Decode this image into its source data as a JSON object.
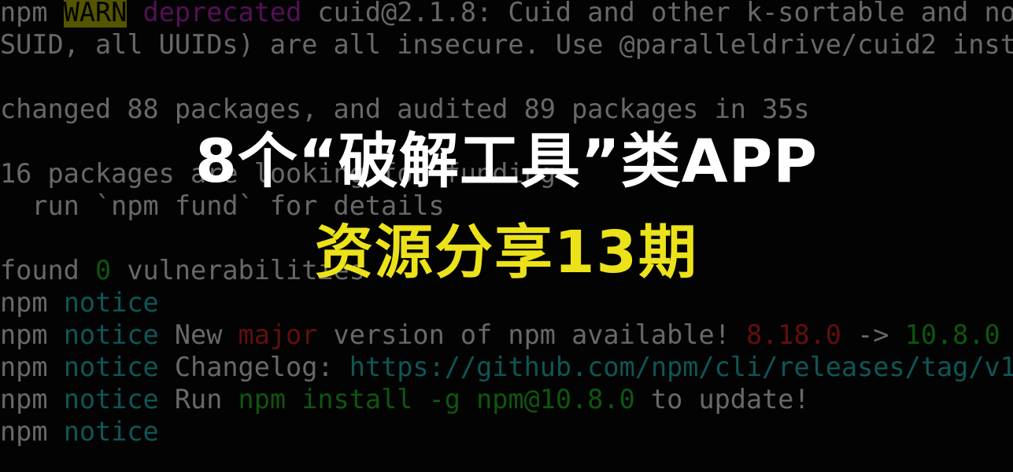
{
  "colors": {
    "background": "#050505",
    "text": "#a9a9a9",
    "green": "#1a8a1a",
    "red": "#a01818",
    "magenta": "#8a1a8a",
    "cyan": "#1a8a8a",
    "warn_badge_bg": "#8a8a00",
    "title_main": "#ffffff",
    "title_sub": "#ece21a"
  },
  "terminal": {
    "lines": [
      {
        "segments": [
          {
            "text": "npm ",
            "style": "white"
          },
          {
            "text": "WARN",
            "style": "warn"
          },
          {
            "text": " ",
            "style": "white"
          },
          {
            "text": "deprecated",
            "style": "magenta"
          },
          {
            "text": " cuid@2.1.8: Cuid and other k-sortable and no",
            "style": "white"
          }
        ]
      },
      {
        "segments": [
          {
            "text": "SUID, all UUIDs) are all insecure. Use @paralleldrive/cuid2 inst",
            "style": "white"
          }
        ]
      },
      {
        "segments": []
      },
      {
        "segments": [
          {
            "text": "changed 88 packages, and audited 89 packages in 35s",
            "style": "white"
          }
        ]
      },
      {
        "segments": []
      },
      {
        "segments": [
          {
            "text": "16 packages are looking for funding",
            "style": "white"
          }
        ]
      },
      {
        "segments": [
          {
            "text": "  run `npm fund` for details",
            "style": "white"
          }
        ]
      },
      {
        "segments": []
      },
      {
        "segments": [
          {
            "text": "found ",
            "style": "white"
          },
          {
            "text": "0",
            "style": "green"
          },
          {
            "text": " vulnerabilities",
            "style": "white"
          }
        ]
      },
      {
        "segments": [
          {
            "text": "npm ",
            "style": "white"
          },
          {
            "text": "notice",
            "style": "cyan"
          }
        ]
      },
      {
        "segments": [
          {
            "text": "npm ",
            "style": "white"
          },
          {
            "text": "notice",
            "style": "cyan"
          },
          {
            "text": " New ",
            "style": "white"
          },
          {
            "text": "major",
            "style": "red"
          },
          {
            "text": " version of npm available! ",
            "style": "white"
          },
          {
            "text": "8.18.0",
            "style": "red"
          },
          {
            "text": " -> ",
            "style": "white"
          },
          {
            "text": "10.8.0",
            "style": "green"
          }
        ]
      },
      {
        "segments": [
          {
            "text": "npm ",
            "style": "white"
          },
          {
            "text": "notice",
            "style": "cyan"
          },
          {
            "text": " Changelog: ",
            "style": "white"
          },
          {
            "text": "https://github.com/npm/cli/releases/tag/v1",
            "style": "cyan"
          }
        ]
      },
      {
        "segments": [
          {
            "text": "npm ",
            "style": "white"
          },
          {
            "text": "notice",
            "style": "cyan"
          },
          {
            "text": " Run ",
            "style": "white"
          },
          {
            "text": "npm install -g npm@10.8.0",
            "style": "green"
          },
          {
            "text": " to update!",
            "style": "white"
          }
        ]
      },
      {
        "segments": [
          {
            "text": "npm ",
            "style": "white"
          },
          {
            "text": "notice",
            "style": "cyan"
          }
        ]
      }
    ]
  },
  "overlay": {
    "title": "8个“破解工具”类APP",
    "subtitle": "资源分享13期"
  }
}
